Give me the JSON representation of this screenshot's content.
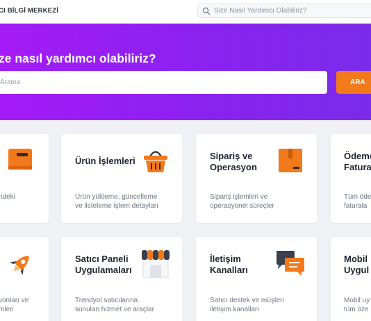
{
  "header": {
    "brand": "CI BİLGİ MERKEZİ",
    "search_placeholder": "Size Nasıl Yardımcı Olabiliriz?"
  },
  "hero": {
    "title": "ze nasıl yardımcı olabiliriz?",
    "search_placeholder": "Arama",
    "search_button": "ARA"
  },
  "colors": {
    "accent": "#f27a1a",
    "hero_start": "#a51bf7",
    "hero_end": "#7b2bea"
  },
  "cards": [
    {
      "title": "",
      "desc": "ndeki",
      "icon": "book-icon"
    },
    {
      "title": "Ürün İşlemleri",
      "desc": "Ürün yükleme, güncelleme\nve listeleme işlem detayları",
      "icon": "basket-icon"
    },
    {
      "title": "Sipariş ve\nOperasyon",
      "desc": "Sipariş işlemleri ve\noperasyonel süreçler",
      "icon": "box-icon"
    },
    {
      "title": "Ödeme\nFatura",
      "desc": "Tüm öde\nfaturala",
      "icon": "payment-icon"
    },
    {
      "title": "",
      "desc": "vonları ve\nmleri",
      "icon": "rocket-icon"
    },
    {
      "title": "Satıcı Paneli\nUygulamaları",
      "desc": "Trendyol satıcılarına\nsunulan hizmet ve araçlar",
      "icon": "store-icon"
    },
    {
      "title": "İletişim\nKanalları",
      "desc": "Satıcı destek ve müşteri\niletişim kanalları",
      "icon": "chat-icon"
    },
    {
      "title": "Mobil\nUygul",
      "desc": "Mobil uy\ntüm öze",
      "icon": "mobile-icon"
    }
  ]
}
